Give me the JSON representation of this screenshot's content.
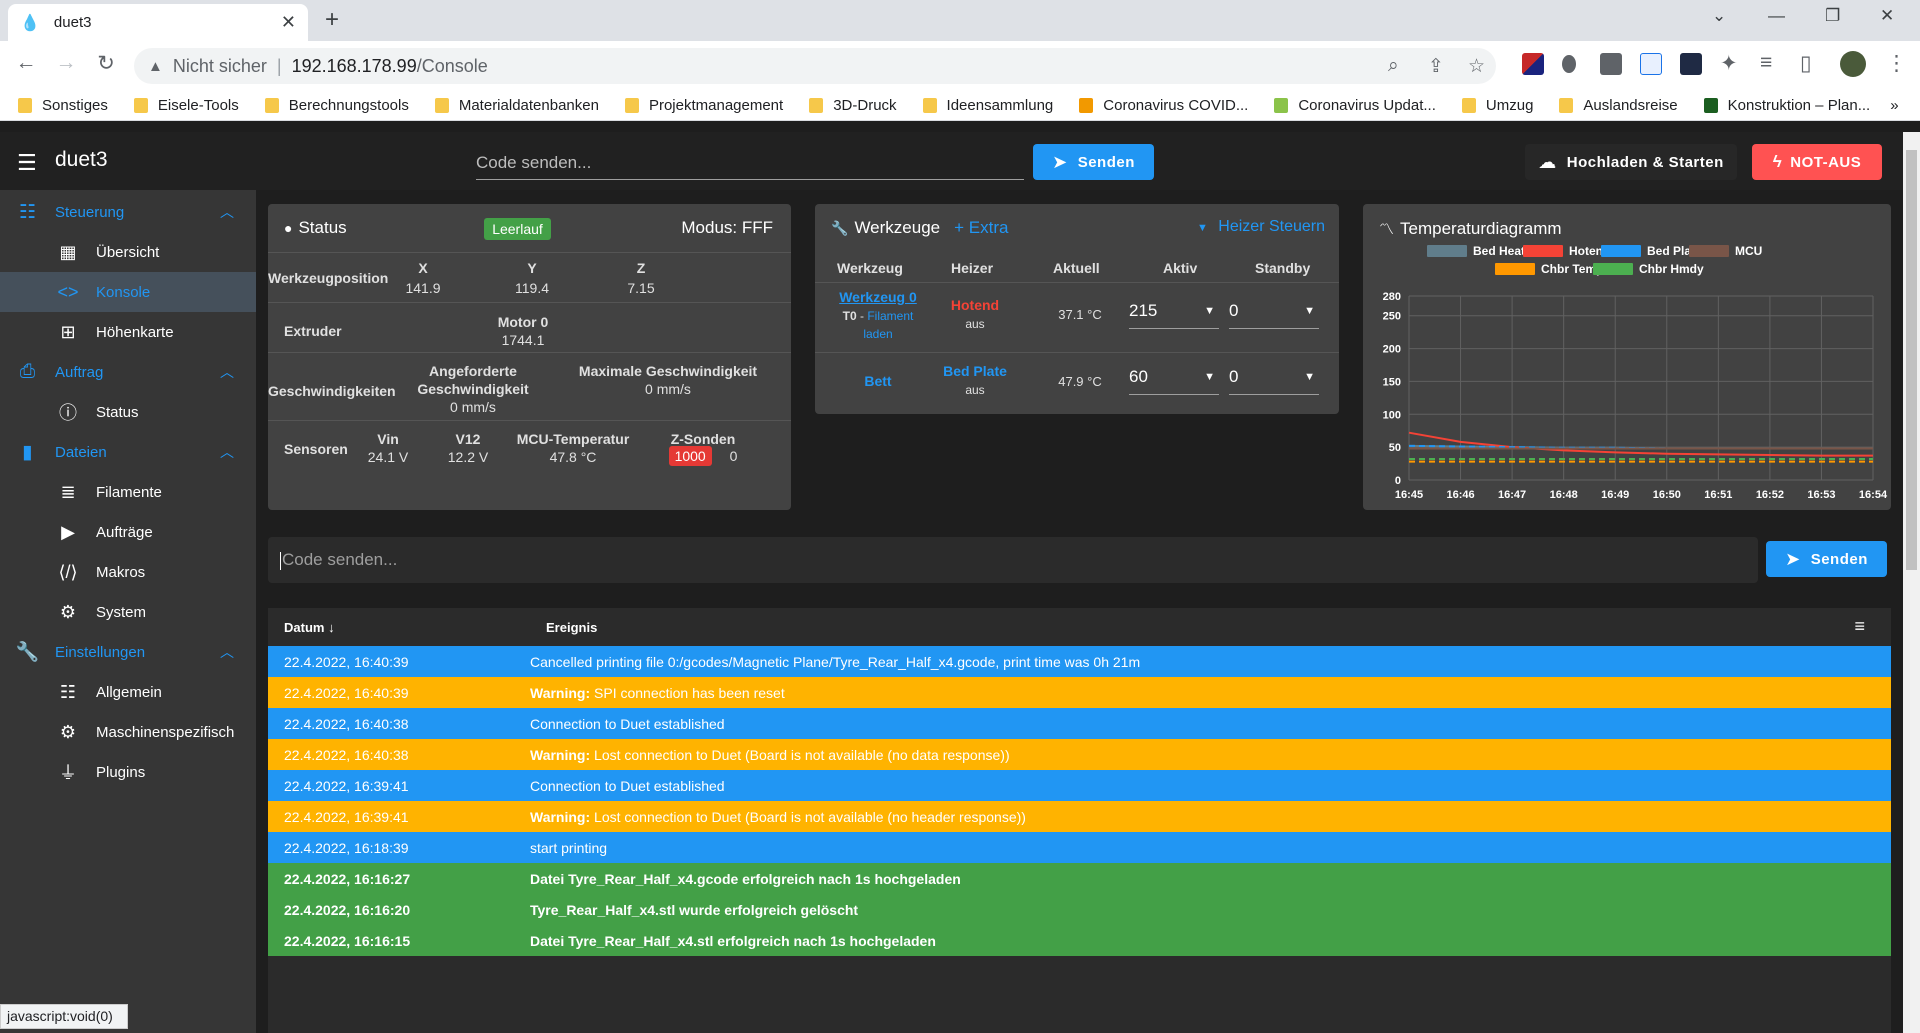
{
  "browser": {
    "tab_title": "duet3",
    "url_insecure": "Nicht sicher",
    "url_host": "192.168.178.99",
    "url_path": "/Console",
    "bookmarks": [
      "Sonstiges",
      "Eisele-Tools",
      "Berechnungstools",
      "Materialdatenbanken",
      "Projektmanagement",
      "3D-Druck",
      "Ideensammlung",
      "Coronavirus COVID...",
      "Coronavirus Updat...",
      "Umzug",
      "Auslandsreise",
      "Konstruktion – Plan..."
    ],
    "status_url": "javascript:void(0)"
  },
  "appbar": {
    "title": "duet3",
    "code_placeholder": "Code senden...",
    "send_label": "Senden",
    "upload_label": "Hochladen & Starten",
    "estop_label": "NOT-AUS"
  },
  "sidebar": {
    "groups": [
      {
        "label": "Steuerung",
        "items": [
          "Übersicht",
          "Konsole",
          "Höhenkarte"
        ]
      },
      {
        "label": "Auftrag",
        "items": [
          "Status"
        ]
      },
      {
        "label": "Dateien",
        "items": [
          "Filamente",
          "Aufträge",
          "Makros",
          "System"
        ]
      },
      {
        "label": "Einstellungen",
        "items": [
          "Allgemein",
          "Maschinenspezifisch",
          "Plugins"
        ]
      }
    ]
  },
  "status": {
    "title": "Status",
    "state": "Leerlauf",
    "mode": "Modus: FFF",
    "tool_position_label": "Werkzeugposition",
    "axes": [
      {
        "name": "X",
        "value": "141.9"
      },
      {
        "name": "Y",
        "value": "119.4"
      },
      {
        "name": "Z",
        "value": "7.15"
      }
    ],
    "extruder_label": "Extruder",
    "motor_label": "Motor 0",
    "motor_value": "1744.1",
    "speeds_label": "Geschwindigkeiten",
    "requested_speed_label_1": "Angeforderte",
    "requested_speed_label_2": "Geschwindigkeit",
    "requested_speed_value": "0 mm/s",
    "max_speed_label": "Maximale Geschwindigkeit",
    "max_speed_value": "0 mm/s",
    "sensors_label": "Sensoren",
    "sensors": [
      {
        "name": "Vin",
        "value": "24.1 V"
      },
      {
        "name": "V12",
        "value": "12.2 V"
      },
      {
        "name": "MCU-Temperatur",
        "value": "47.8 °C"
      },
      {
        "name": "Z-Sonden",
        "value": "1000",
        "value2": "0"
      }
    ]
  },
  "tools": {
    "title": "Werkzeuge",
    "extra_label": "Extra",
    "heater_control_label": "Heizer Steuern",
    "columns": [
      "Werkzeug",
      "Heizer",
      "Aktuell",
      "Aktiv",
      "Standby"
    ],
    "rows": [
      {
        "tool": "Werkzeug 0",
        "tool_sub": "T0",
        "filament_link_1": "Filament",
        "filament_link_2": "laden",
        "heater": "Hotend",
        "heater_state": "aus",
        "current": "37.1 °C",
        "active": "215",
        "standby": "0"
      },
      {
        "tool": "Bett",
        "heater": "Bed Plate",
        "heater_state": "aus",
        "current": "47.9 °C",
        "active": "60",
        "standby": "0"
      }
    ]
  },
  "chart": {
    "title": "Temperaturdiagramm",
    "colors": {
      "bed_heater": "#607d8b",
      "hotend": "#f44336",
      "bed_plate": "#2196f3",
      "mcu": "#795548",
      "chbr_temp": "#ff9800",
      "chbr_hmdy": "#4caf50"
    }
  },
  "chart_data": {
    "type": "line",
    "title": "Temperaturdiagramm",
    "x": [
      "16:45",
      "16:46",
      "16:47",
      "16:48",
      "16:49",
      "16:50",
      "16:51",
      "16:52",
      "16:53",
      "16:54"
    ],
    "y_ticks": [
      0,
      50,
      100,
      150,
      200,
      250,
      280
    ],
    "ylim": [
      0,
      280
    ],
    "grid": true,
    "legend_position": "top",
    "series": [
      {
        "name": "Bed Heater",
        "values": [
          52,
          51,
          50,
          49,
          49,
          48,
          48,
          48,
          48,
          48
        ]
      },
      {
        "name": "Hotend",
        "values": [
          72,
          58,
          50,
          45,
          42,
          40,
          39,
          38,
          37,
          37
        ]
      },
      {
        "name": "Bed Plate",
        "values": [
          52,
          51,
          50,
          49,
          49,
          48,
          48,
          48,
          48,
          48
        ]
      },
      {
        "name": "MCU",
        "values": [
          48,
          48,
          48,
          48,
          48,
          48,
          48,
          48,
          48,
          48
        ]
      },
      {
        "name": "Chbr Temp",
        "values": [
          28,
          28,
          28,
          28,
          28,
          28,
          28,
          28,
          28,
          28
        ]
      },
      {
        "name": "Chbr Hmdy",
        "values": [
          32,
          32,
          32,
          32,
          32,
          32,
          32,
          32,
          32,
          32
        ]
      }
    ]
  },
  "console": {
    "placeholder": "Code senden...",
    "send_label": "Senden",
    "col_date": "Datum",
    "col_event": "Ereignis",
    "rows": [
      {
        "type": "info",
        "date": "22.4.2022, 16:40:39",
        "prefix": "",
        "text": "Cancelled printing file 0:/gcodes/Magnetic Plane/Tyre_Rear_Half_x4.gcode, print time was 0h 21m"
      },
      {
        "type": "warn",
        "date": "22.4.2022, 16:40:39",
        "prefix": "Warning:",
        "text": " SPI connection has been reset"
      },
      {
        "type": "info",
        "date": "22.4.2022, 16:40:38",
        "prefix": "",
        "text": "Connection to Duet established"
      },
      {
        "type": "warn",
        "date": "22.4.2022, 16:40:38",
        "prefix": "Warning:",
        "text": " Lost connection to Duet (Board is not available (no data response))"
      },
      {
        "type": "info",
        "date": "22.4.2022, 16:39:41",
        "prefix": "",
        "text": "Connection to Duet established"
      },
      {
        "type": "warn",
        "date": "22.4.2022, 16:39:41",
        "prefix": "Warning:",
        "text": " Lost connection to Duet (Board is not available (no header response))"
      },
      {
        "type": "info",
        "date": "22.4.2022, 16:18:39",
        "prefix": "",
        "text": "start printing"
      },
      {
        "type": "ok",
        "date": "22.4.2022, 16:16:27",
        "prefix": "",
        "text": "Datei Tyre_Rear_Half_x4.gcode erfolgreich nach 1s hochgeladen"
      },
      {
        "type": "ok",
        "date": "22.4.2022, 16:16:20",
        "prefix": "",
        "text": "Tyre_Rear_Half_x4.stl wurde erfolgreich gelöscht"
      },
      {
        "type": "ok",
        "date": "22.4.2022, 16:16:15",
        "prefix": "",
        "text": "Datei Tyre_Rear_Half_x4.stl erfolgreich nach 1s hochgeladen"
      }
    ]
  }
}
